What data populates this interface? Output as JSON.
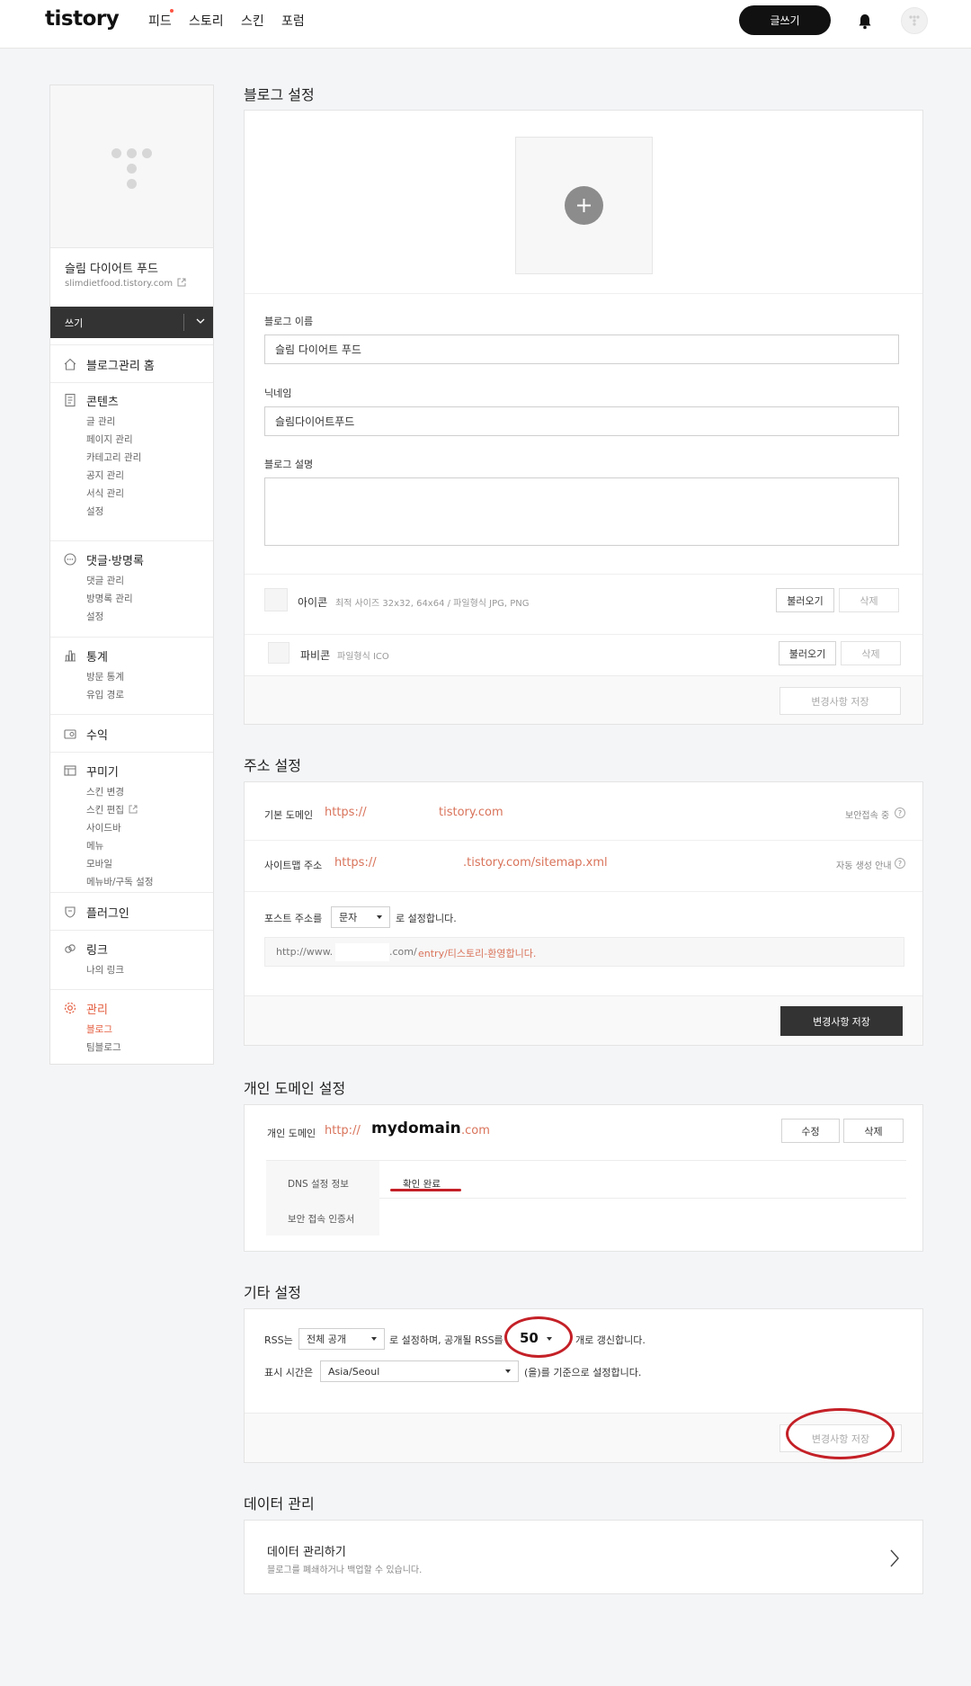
{
  "header": {
    "logo": "tistory",
    "nav": [
      "피드",
      "스토리",
      "스킨",
      "포럼"
    ],
    "write_button": "글쓰기"
  },
  "sidebar": {
    "blog_name": "슬림 다이어트 푸드",
    "blog_url": "slimdietfood.tistory.com",
    "write_label": "쓰기",
    "sections": [
      {
        "title": "블로그관리 홈",
        "icon": "home-icon",
        "items": []
      },
      {
        "title": "콘텐츠",
        "icon": "document-icon",
        "items": [
          "글 관리",
          "페이지 관리",
          "카테고리 관리",
          "공지 관리",
          "서식 관리",
          "설정"
        ]
      },
      {
        "title": "댓글·방명록",
        "icon": "comment-icon",
        "items": [
          "댓글 관리",
          "방명록 관리",
          "설정"
        ]
      },
      {
        "title": "통계",
        "icon": "chart-icon",
        "items": [
          "방문 통계",
          "유입 경로"
        ]
      },
      {
        "title": "수익",
        "icon": "revenue-icon",
        "items": []
      },
      {
        "title": "꾸미기",
        "icon": "layout-icon",
        "items": [
          "스킨 변경",
          "스킨 편집",
          "사이드바",
          "메뉴",
          "모바일",
          "메뉴바/구독 설정"
        ]
      },
      {
        "title": "플러그인",
        "icon": "plugin-icon",
        "items": []
      },
      {
        "title": "링크",
        "icon": "link-icon",
        "items": [
          "나의 링크"
        ]
      },
      {
        "title": "관리",
        "icon": "gear-icon",
        "items": [
          "블로그",
          "팀블로그"
        ]
      }
    ]
  },
  "blog_settings": {
    "title": "블로그 설정",
    "name_label": "블로그 이름",
    "name_value": "슬림 다이어트 푸드",
    "nickname_label": "닉네임",
    "nickname_value": "슬림다이어트푸드",
    "desc_label": "블로그 설명",
    "desc_value": "",
    "icon_label": "아이콘",
    "icon_hint": "최적 사이즈 32x32, 64x64 / 파일형식 JPG, PNG",
    "favicon_label": "파비콘",
    "favicon_hint": "파일형식 ICO",
    "load_button": "불러오기",
    "delete_button": "삭제",
    "save_button": "변경사항 저장"
  },
  "address_settings": {
    "title": "주소 설정",
    "domain_label": "기본 도메인",
    "domain_prefix": "https://",
    "domain_suffix": "tistory.com",
    "secure_label": "보안접속 중",
    "sitemap_label": "사이트맵 주소",
    "sitemap_prefix": "https://",
    "sitemap_suffix": ".tistory.com/sitemap.xml",
    "sitemap_auto": "자동 생성 안내",
    "post_label_pre": "포스트 주소를",
    "post_select": "문자",
    "post_label_post": "로 설정합니다.",
    "preview_prefix": "http://www.",
    "preview_mid": ".com/",
    "preview_suffix": "entry/티스토리-환영합니다.",
    "save_button": "변경사항 저장"
  },
  "custom_domain": {
    "title": "개인 도메인 설정",
    "label": "개인 도메인",
    "prefix": "http://",
    "domain": "mydomain",
    "suffix": ".com",
    "edit_button": "수정",
    "delete_button": "삭제",
    "dns_label": "DNS 설정 정보",
    "dns_value": "확인 완료",
    "cert_label": "보안 접속 인증서"
  },
  "other_settings": {
    "title": "기타 설정",
    "rss_pre": "RSS는",
    "rss_select": "전체 공개",
    "rss_mid": "로 설정하며, 공개될 RSS를",
    "rss_count": "50",
    "rss_post": "개로 갱신합니다.",
    "time_label": "표시 시간은",
    "time_select": "Asia/Seoul",
    "time_post": "(을)를 기준으로 설정합니다.",
    "save_button": "변경사항 저장"
  },
  "data_management": {
    "title": "데이터 관리",
    "card_title": "데이터 관리하기",
    "card_desc": "블로그를 폐쇄하거나 백업할 수 있습니다."
  },
  "colors": {
    "accent_red": "#e35d3f",
    "annotation_red": "#c42027",
    "dark": "#333333"
  }
}
